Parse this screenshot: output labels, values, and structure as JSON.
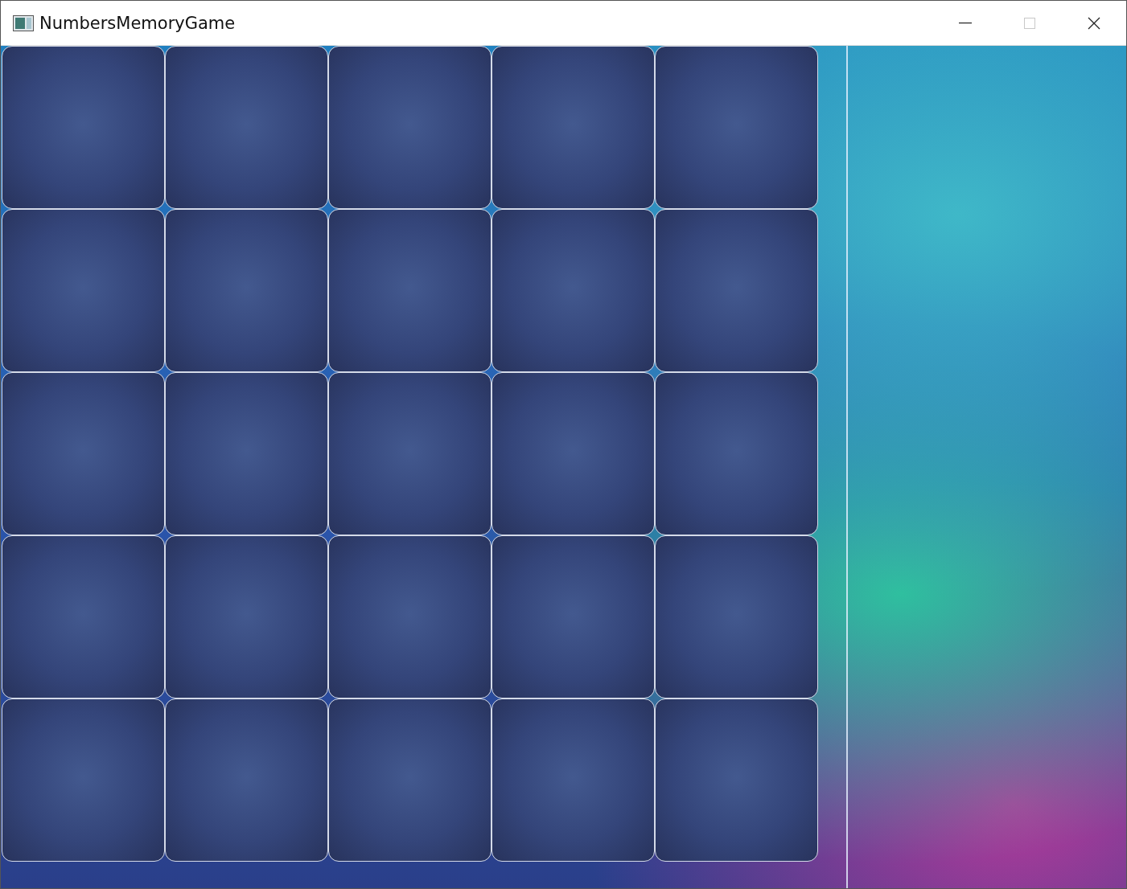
{
  "window": {
    "title": "NumbersMemoryGame"
  },
  "cards": [
    {
      "kind": "hidden"
    },
    {
      "kind": "hidden"
    },
    {
      "kind": "hidden"
    },
    {
      "kind": "hidden"
    },
    {
      "kind": "hidden"
    },
    {
      "kind": "hidden"
    },
    {
      "kind": "hidden"
    },
    {
      "kind": "hidden"
    },
    {
      "kind": "hidden"
    },
    {
      "kind": "hidden"
    },
    {
      "kind": "hidden"
    },
    {
      "kind": "hidden"
    },
    {
      "kind": "hidden"
    },
    {
      "kind": "hidden"
    },
    {
      "kind": "hidden"
    },
    {
      "kind": "hidden"
    },
    {
      "kind": "hidden"
    },
    {
      "kind": "hidden"
    },
    {
      "kind": "hidden"
    },
    {
      "kind": "hidden"
    },
    {
      "kind": "hidden"
    },
    {
      "kind": "hidden"
    },
    {
      "kind": "hidden"
    },
    {
      "kind": "hidden"
    },
    {
      "kind": "hidden"
    }
  ]
}
